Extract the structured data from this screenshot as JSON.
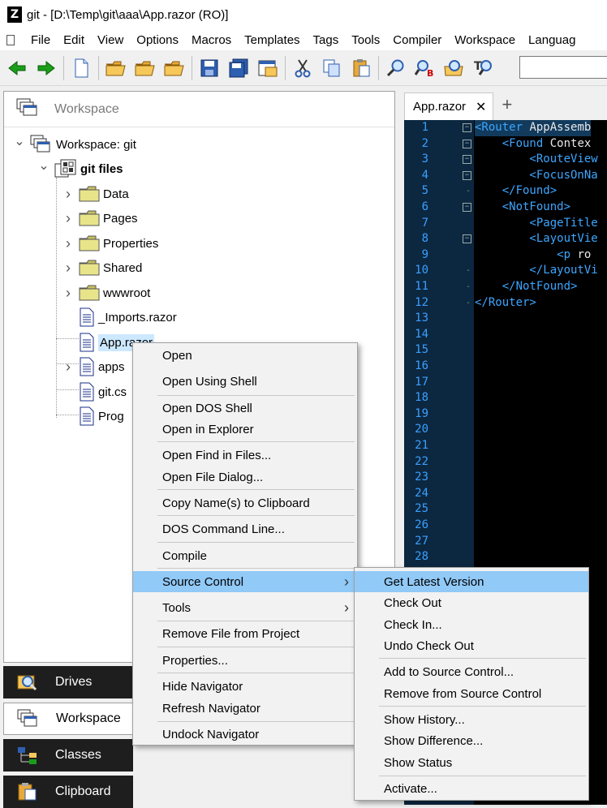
{
  "window": {
    "title": "git - [D:\\Temp\\git\\aaa\\App.razor (RO)]",
    "logo": "Z"
  },
  "menubar": [
    "File",
    "Edit",
    "View",
    "Options",
    "Macros",
    "Templates",
    "Tags",
    "Tools",
    "Compiler",
    "Workspace",
    "Languag"
  ],
  "toolbar_icons": [
    "back-arrow-icon",
    "forward-arrow-icon",
    "new-file-icon",
    "open-folder-icon",
    "open-folder-2-icon",
    "open-folder-3-icon",
    "save-icon",
    "save-all-icon",
    "window-icon",
    "cut-icon",
    "copy-icon",
    "paste-icon",
    "find-icon",
    "find-replace-icon",
    "find-files-icon",
    "find-text-icon"
  ],
  "navigator": {
    "header": "Workspace",
    "tree": [
      {
        "label": "Workspace: git",
        "level": 0,
        "icon": "workspace-icon",
        "expanded": true
      },
      {
        "label": "git files",
        "level": 1,
        "icon": "project-icon",
        "expanded": true,
        "bold": true
      },
      {
        "label": "Data",
        "level": 2,
        "icon": "folder-icon",
        "collapsed": true
      },
      {
        "label": "Pages",
        "level": 2,
        "icon": "folder-icon",
        "collapsed": true
      },
      {
        "label": "Properties",
        "level": 2,
        "icon": "folder-icon",
        "collapsed": true
      },
      {
        "label": "Shared",
        "level": 2,
        "icon": "folder-icon",
        "collapsed": true
      },
      {
        "label": "wwwroot",
        "level": 2,
        "icon": "folder-icon",
        "collapsed": true
      },
      {
        "label": "_Imports.razor",
        "level": 2,
        "icon": "file-icon"
      },
      {
        "label": "App.razor",
        "level": 2,
        "icon": "file-icon",
        "selected": true
      },
      {
        "label": "apps",
        "level": 2,
        "icon": "file-icon",
        "collapsed": true
      },
      {
        "label": "git.cs",
        "level": 2,
        "icon": "file-icon"
      },
      {
        "label": "Prog",
        "level": 2,
        "icon": "file-icon"
      }
    ]
  },
  "bottom_tabs": [
    {
      "label": "Drives",
      "icon": "drives-icon",
      "active": false
    },
    {
      "label": "Workspace",
      "icon": "workspace-icon",
      "active": true
    },
    {
      "label": "Classes",
      "icon": "classes-icon",
      "active": false
    },
    {
      "label": "Clipboard",
      "icon": "clipboard-icon",
      "active": false
    }
  ],
  "editor": {
    "tab": "App.razor",
    "new_tab": "+",
    "lines": [
      {
        "n": "1",
        "fold": "box",
        "tag": "<Router",
        "rest": " AppAssemb"
      },
      {
        "n": "2",
        "fold": "box",
        "tag": "    <Found",
        "rest": " Contex"
      },
      {
        "n": "3",
        "fold": "box",
        "tag": "        <RouteView",
        "rest": ""
      },
      {
        "n": "4",
        "fold": "box",
        "tag": "        <FocusOnNa",
        "rest": ""
      },
      {
        "n": "5",
        "fold": "dot",
        "tag": "    </Found>",
        "rest": ""
      },
      {
        "n": "6",
        "fold": "box",
        "tag": "    <NotFound>",
        "rest": ""
      },
      {
        "n": "7",
        "fold": "",
        "tag": "        <PageTitle",
        "rest": ""
      },
      {
        "n": "8",
        "fold": "box",
        "tag": "        <LayoutVie",
        "rest": ""
      },
      {
        "n": "9",
        "fold": "",
        "tag": "            <p",
        "rest": " ro"
      },
      {
        "n": "10",
        "fold": "dot",
        "tag": "        </LayoutVi",
        "rest": ""
      },
      {
        "n": "11",
        "fold": "dot",
        "tag": "    </NotFound>",
        "rest": ""
      },
      {
        "n": "12",
        "fold": "dot",
        "tag": "</Router>",
        "rest": ""
      },
      {
        "n": "13",
        "fold": "",
        "tag": "",
        "rest": ""
      },
      {
        "n": "14",
        "fold": "",
        "tag": "",
        "rest": ""
      },
      {
        "n": "15",
        "fold": "",
        "tag": "",
        "rest": ""
      },
      {
        "n": "16",
        "fold": "",
        "tag": "",
        "rest": ""
      },
      {
        "n": "17",
        "fold": "",
        "tag": "",
        "rest": ""
      },
      {
        "n": "18",
        "fold": "",
        "tag": "",
        "rest": ""
      },
      {
        "n": "19",
        "fold": "",
        "tag": "",
        "rest": ""
      },
      {
        "n": "20",
        "fold": "",
        "tag": "",
        "rest": ""
      },
      {
        "n": "21",
        "fold": "",
        "tag": "",
        "rest": ""
      },
      {
        "n": "22",
        "fold": "",
        "tag": "",
        "rest": ""
      },
      {
        "n": "23",
        "fold": "",
        "tag": "",
        "rest": ""
      },
      {
        "n": "24",
        "fold": "",
        "tag": "",
        "rest": ""
      },
      {
        "n": "25",
        "fold": "",
        "tag": "",
        "rest": ""
      },
      {
        "n": "26",
        "fold": "",
        "tag": "",
        "rest": ""
      },
      {
        "n": "27",
        "fold": "",
        "tag": "",
        "rest": ""
      },
      {
        "n": "28",
        "fold": "",
        "tag": "",
        "rest": ""
      }
    ]
  },
  "context_menu": {
    "groups": [
      [
        "Open",
        "Open Using Shell"
      ],
      [
        "Open DOS Shell",
        "Open in Explorer"
      ],
      [
        "Open Find in Files...",
        "Open File Dialog..."
      ],
      [
        "Copy Name(s) to Clipboard"
      ],
      [
        "DOS Command Line..."
      ],
      [
        "Compile"
      ],
      [
        "Source Control",
        "Tools"
      ],
      [
        "Remove File from Project"
      ],
      [
        "Properties..."
      ],
      [
        "Hide Navigator",
        "Refresh Navigator"
      ],
      [
        "Undock Navigator"
      ]
    ],
    "highlighted": "Source Control",
    "submenu_items": [
      "Source Control",
      "Tools"
    ]
  },
  "submenu": {
    "groups": [
      [
        "Get Latest Version",
        "Check Out",
        "Check In...",
        "Undo Check Out"
      ],
      [
        "Add to Source Control...",
        "Remove from Source Control"
      ],
      [
        "Show History...",
        "Show Difference...",
        "Show Status"
      ],
      [
        "Activate..."
      ]
    ],
    "highlighted": "Get Latest Version"
  },
  "colors": {
    "highlight": "#91c9f7",
    "selection": "#cce8ff",
    "editor_bg": "#000000",
    "gutter_bg": "#0c2740",
    "code_tag": "#3da6ff"
  }
}
